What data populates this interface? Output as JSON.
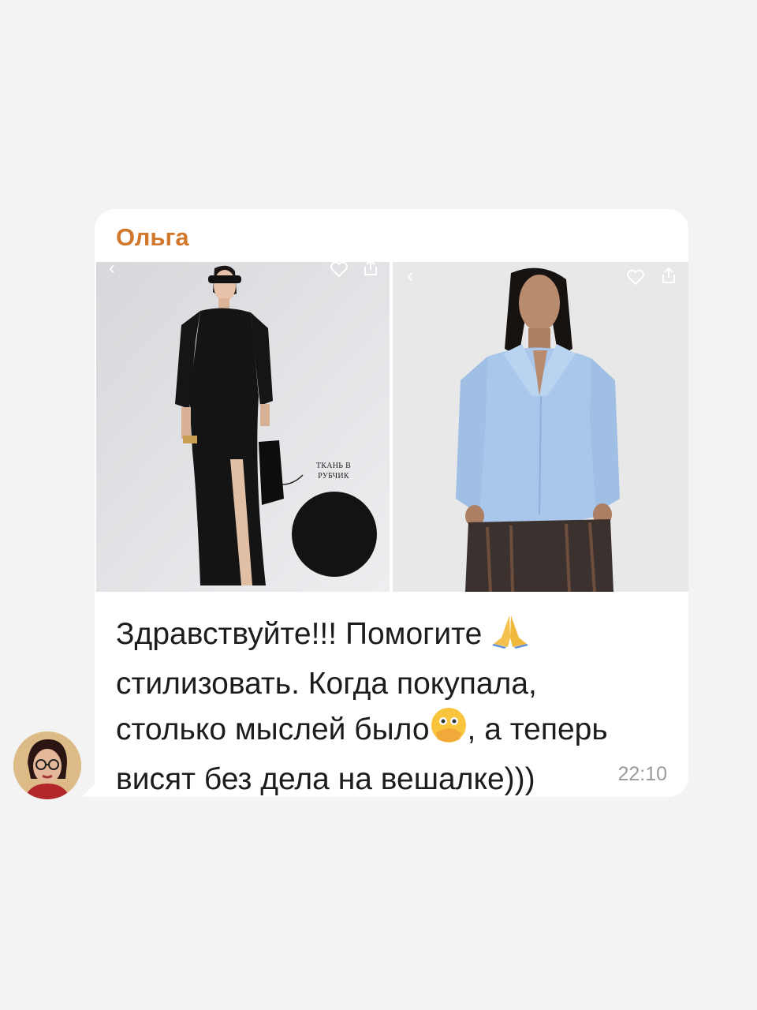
{
  "chat": {
    "sender_name": "Ольга",
    "message_lines": [
      "Здравствуйте!!! Помогите",
      "стилизовать. Когда покупала,",
      "столько мыслей было",
      ", а теперь",
      "висят без дела на вешалке)))"
    ],
    "time": "22:10",
    "emojis": [
      "folded-hands-emoji",
      "face-with-open-eyes-and-hand-over-mouth-emoji"
    ]
  },
  "photos": [
    {
      "caption_line1": "ТКАНЬ В",
      "caption_line2": "РУБЧИК",
      "icons": [
        "back-chevron-icon",
        "heart-icon",
        "share-icon"
      ]
    },
    {
      "icons": [
        "back-chevron-icon",
        "heart-icon",
        "share-icon"
      ]
    }
  ],
  "colors": {
    "background": "#f3f3f3",
    "bubble": "#ffffff",
    "sender": "#d2782c",
    "text": "#1c1c1c",
    "time": "#9a9a9a"
  }
}
